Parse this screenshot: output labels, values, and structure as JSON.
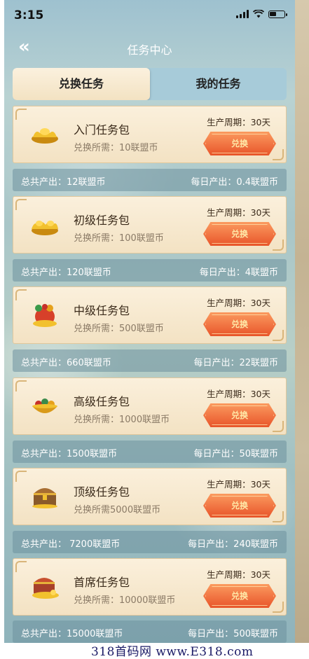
{
  "status": {
    "time": "3:15"
  },
  "nav": {
    "title": "任务中心"
  },
  "tabs": [
    {
      "label": "兑换任务",
      "active": true
    },
    {
      "label": "我的任务",
      "active": false
    }
  ],
  "cards": [
    {
      "name": "入门任务包",
      "cost": "兑换所需：10联盟币",
      "period": "生产周期：30天",
      "button": "兑换",
      "total": "总共产出：12联盟币",
      "daily": "每日产出：0.4联盟币",
      "icon": "gold-ingot-icon"
    },
    {
      "name": "初级任务包",
      "cost": "兑换所需：100联盟币",
      "period": "生产周期：30天",
      "button": "兑换",
      "total": "总共产出：120联盟币",
      "daily": "每日产出：4联盟币",
      "icon": "gold-ingot-pile-icon"
    },
    {
      "name": "中级任务包",
      "cost": "兑换所需：500联盟币",
      "period": "生产周期：30天",
      "button": "兑换",
      "total": "总共产出：660联盟币",
      "daily": "每日产出：22联盟币",
      "icon": "treasure-bag-icon"
    },
    {
      "name": "高级任务包",
      "cost": "兑换所需：1000联盟币",
      "period": "生产周期：30天",
      "button": "兑换",
      "total": "总共产出：1500联盟币",
      "daily": "每日产出：50联盟币",
      "icon": "jewel-bowl-icon"
    },
    {
      "name": "顶级任务包",
      "cost": "兑换所需5000联盟币",
      "period": "生产周期：30天",
      "button": "兑换",
      "total": "总共产出： 7200联盟币",
      "daily": "每日产出：240联盟币",
      "icon": "treasure-chest-icon"
    },
    {
      "name": "首席任务包",
      "cost": "兑换所需：10000联盟币",
      "period": "生产周期：30天",
      "button": "兑换",
      "total": "总共产出：15000联盟币",
      "daily": "每日产出：500联盟币",
      "icon": "treasure-chest-gold-icon"
    }
  ],
  "watermark": "318首码网 www.E318.com",
  "colors": {
    "button": "#e8552a",
    "card": "#f3e2c3",
    "tab_bg": "#a7cbd9"
  }
}
